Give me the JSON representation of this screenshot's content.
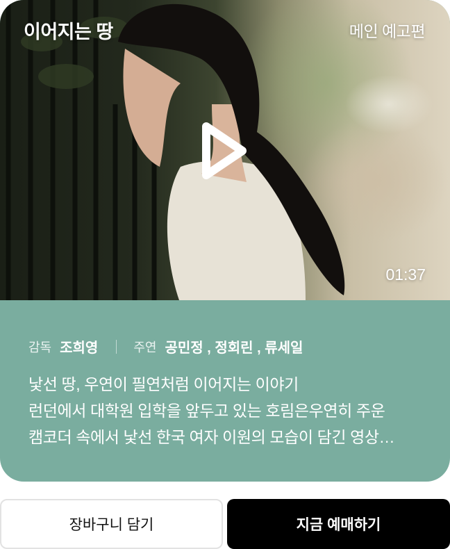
{
  "video": {
    "title": "이어지는 땅",
    "trailer_label": "메인 예고편",
    "duration": "01:37"
  },
  "info": {
    "director_label": "감독",
    "director": "조희영",
    "cast_label": "주연",
    "cast": "공민정 , 정회린 , 류세일",
    "description_lines": [
      "낯선 땅, 우연이 필연처럼 이어지는 이야기",
      "런던에서 대학원 입학을 앞두고 있는 호림은우연히 주운",
      "캠코더 속에서 낯선 한국 여자 이원의 모습이 담긴 영상…"
    ]
  },
  "actions": {
    "cart_label": "장바구니 담기",
    "book_label": "지금 예매하기"
  },
  "colors": {
    "info_background": "#7aad9f",
    "book_button": "#000000",
    "cart_button": "#ffffff"
  }
}
